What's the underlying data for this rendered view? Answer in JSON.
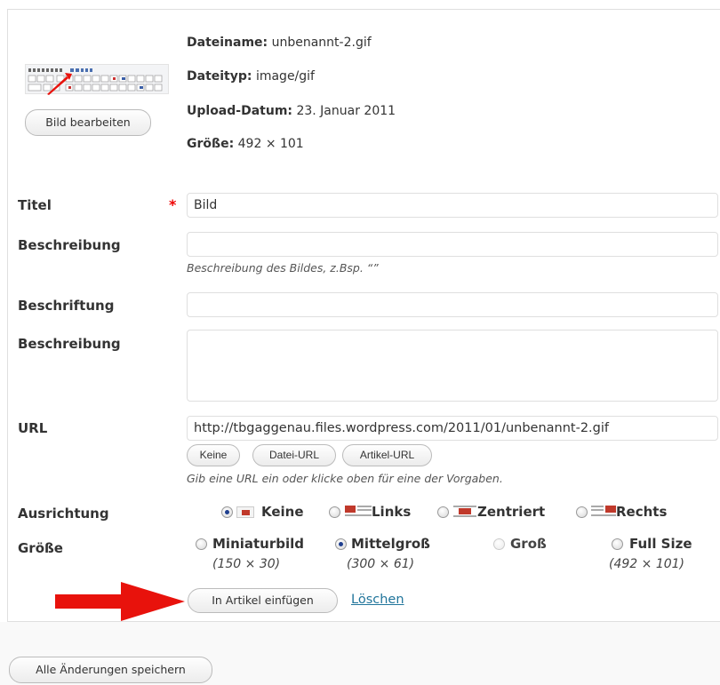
{
  "file_meta": {
    "filename_label": "Dateiname:",
    "filename_value": "unbenannt-2.gif",
    "filetype_label": "Dateityp:",
    "filetype_value": "image/gif",
    "upload_label": "Upload-Datum:",
    "upload_value": "23. Januar 2011",
    "size_label": "Größe:",
    "size_value": "492 × 101"
  },
  "edit_image_button": "Bild bearbeiten",
  "fields": {
    "title_label": "Titel",
    "title_required": "*",
    "title_value": "Bild",
    "description_label": "Beschreibung",
    "description_value": "",
    "description_help": "Beschreibung des Bildes, z.Bsp. “”",
    "caption_label": "Beschriftung",
    "caption_value": "",
    "longdesc_label": "Beschreibung",
    "longdesc_value": "",
    "url_label": "URL",
    "url_value": "http://tbgaggenau.files.wordpress.com/2011/01/unbenannt-2.gif",
    "url_buttons": [
      "Keine",
      "Datei-URL",
      "Artikel-URL"
    ],
    "url_help": "Gib eine URL ein oder klicke oben für eine der Vorgaben."
  },
  "alignment": {
    "label": "Ausrichtung",
    "selected": "Keine",
    "options": [
      "Keine",
      "Links",
      "Zentriert",
      "Rechts"
    ]
  },
  "size": {
    "label": "Größe",
    "selected": "Mittelgroß",
    "options": [
      {
        "label": "Miniaturbild",
        "dims": "(150 × 30)",
        "enabled": true
      },
      {
        "label": "Mittelgroß",
        "dims": "(300 × 61)",
        "enabled": true
      },
      {
        "label": "Groß",
        "dims": "",
        "enabled": false
      },
      {
        "label": "Full Size",
        "dims": "(492 × 101)",
        "enabled": true
      }
    ]
  },
  "actions": {
    "insert_button": "In Artikel einfügen",
    "delete_link": "Löschen",
    "save_all_button": "Alle Änderungen speichern"
  },
  "colors": {
    "arrow": "#e8120c",
    "link": "#21759b",
    "required": "#ee0000",
    "border": "#dfdfdf"
  }
}
